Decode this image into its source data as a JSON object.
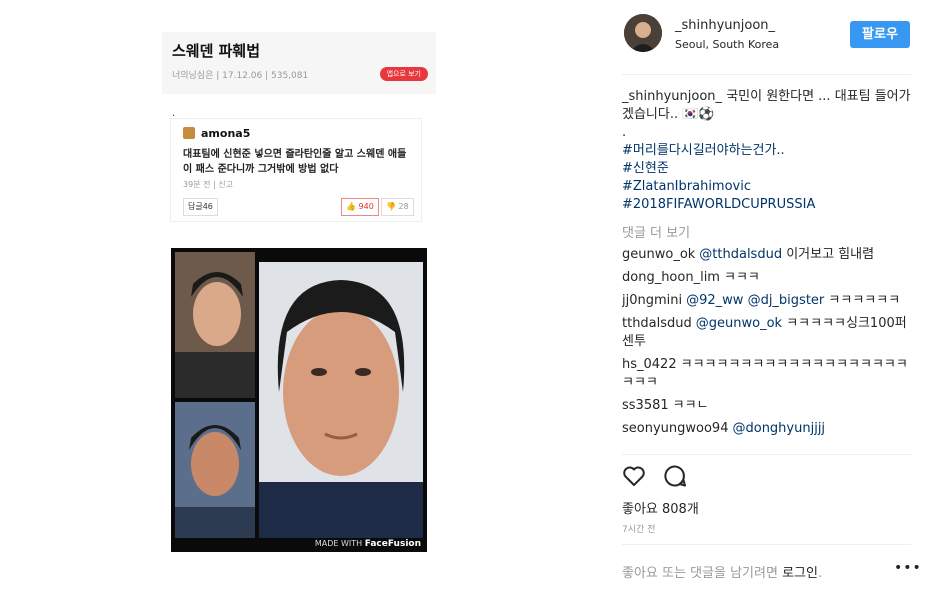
{
  "article": {
    "title": "스웨덴 파훼법",
    "meta": "너의닝심은 | 17.12.06 | 535,081",
    "app_button": "앱으로 보기",
    "dot": ".",
    "comment": {
      "user": "amona5",
      "text": "대표팀에 신현준 넣으면 즐라탄인줄 알고 스웨덴 애들이 패스 준다니까 그거밖에 방법 없다",
      "meta": "39분 전 | 신고",
      "reply_label": "답글46",
      "likes": "940",
      "dislikes": "28"
    },
    "watermark_prefix": "MADE WITH ",
    "watermark_brand": "FaceFusion"
  },
  "post": {
    "username": "_shinhyunjoon_",
    "location": "Seoul, South Korea",
    "follow_label": "팔로우",
    "caption_user": "_shinhyunjoon_",
    "caption_text": "국민이 원한다면 ... 대표팀 들어가겠습니다.. 🇰🇷⚽",
    "caption_dot": ".",
    "hashtags": [
      "#머리를다시길러야하는건가..",
      "#신현준",
      "#ZlatanIbrahimovic",
      "#2018FIFAWORLDCUPRUSSIA"
    ],
    "more_comments": "댓글 더 보기",
    "comments": [
      {
        "user": "geunwo_ok",
        "mention": "@tthdalsdud",
        "text": " 이거보고 힘내렴"
      },
      {
        "user": "dong_hoon_lim",
        "mention": "",
        "text": "ㅋㅋㅋ"
      },
      {
        "user": "jj0ngmini",
        "mention": "@92_ww @dj_bigster",
        "text": " ㅋㅋㅋㅋㅋㅋ"
      },
      {
        "user": "tthdalsdud",
        "mention": "@geunwo_ok",
        "text": " ㅋㅋㅋㅋㅋ싱크100퍼센투"
      },
      {
        "user": "hs_0422",
        "mention": "",
        "text": "ㅋㅋㅋㅋㅋㅋㅋㅋㅋㅋㅋㅋㅋㅋㅋㅋㅋㅋㅋㅋㅋㅋ"
      },
      {
        "user": "ss3581",
        "mention": "",
        "text": "ㅋㅋㄴ"
      },
      {
        "user": "seonyungwoo94",
        "mention": "@donghyunjjjj",
        "text": ""
      }
    ],
    "likes_text": "좋아요 808개",
    "time_text": "7시간 전",
    "login_prefix": "좋아요 또는 댓글을 남기려면 ",
    "login_link": "로그인",
    "login_suffix": ".",
    "more_icon": "ellipsis-icon",
    "colors": {
      "follow": "#3897f0",
      "link": "#003569",
      "muted": "#999999"
    }
  }
}
